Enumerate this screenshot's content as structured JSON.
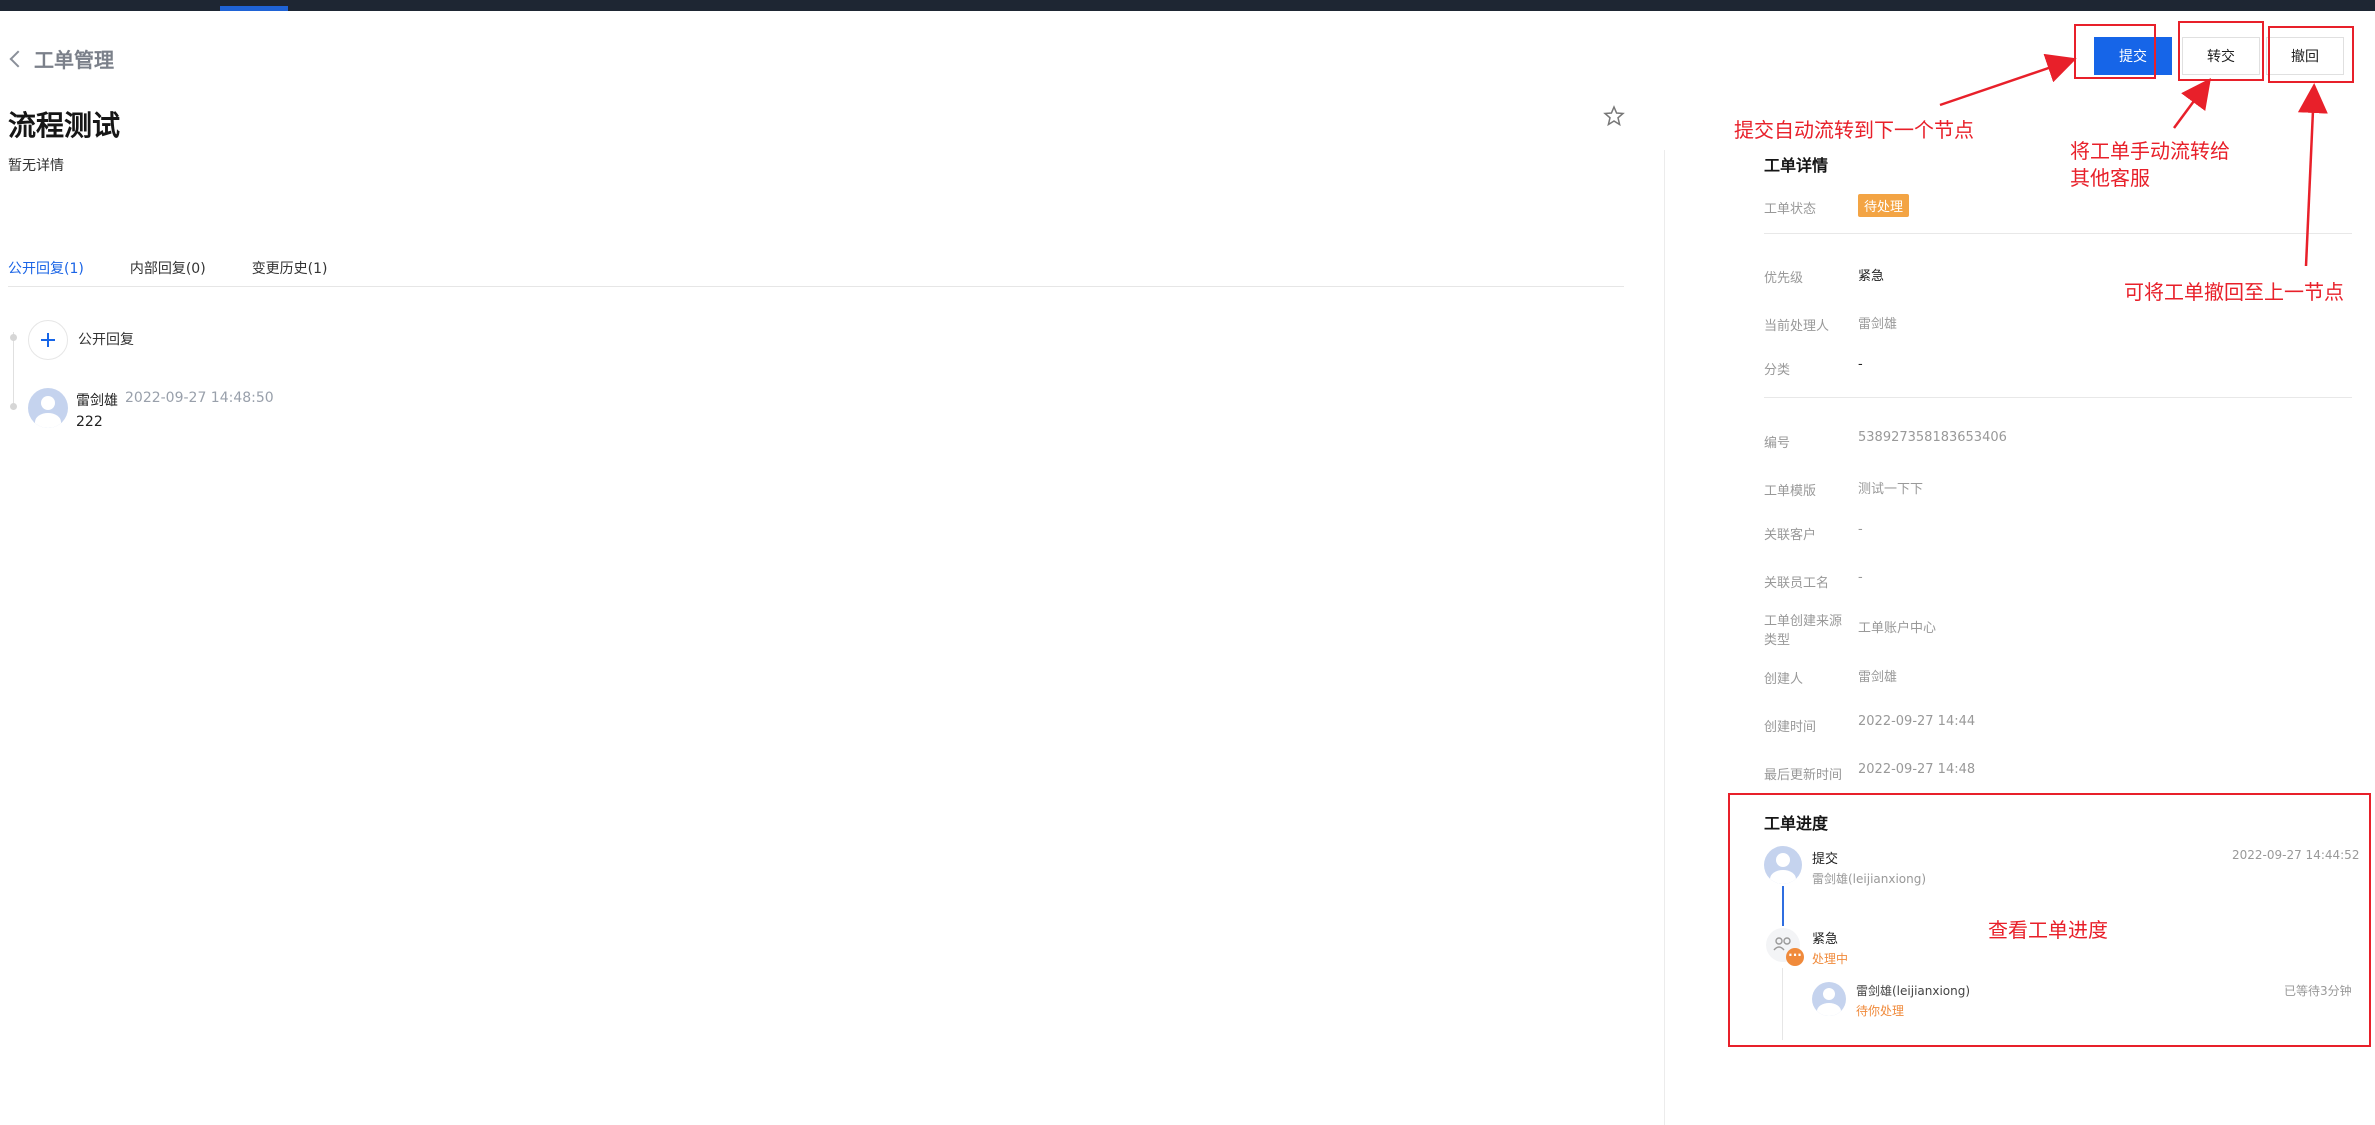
{
  "topbar": {},
  "header": {
    "back_label": "工单管理"
  },
  "ticket": {
    "title": "流程测试",
    "description": "暂无详情"
  },
  "tabs": [
    {
      "label": "公开回复(1)",
      "active": true
    },
    {
      "label": "内部回复(0)",
      "active": false
    },
    {
      "label": "变更历史(1)",
      "active": false
    }
  ],
  "reply_add_label": "公开回复",
  "replies": [
    {
      "author": "雷剑雄",
      "time": "2022-09-27 14:48:50",
      "content": "222"
    }
  ],
  "actions": {
    "submit": "提交",
    "transfer": "转交",
    "withdraw": "撤回"
  },
  "details": {
    "title": "工单详情",
    "status_label": "工单状态",
    "status_value": "待处理",
    "priority_label": "优先级",
    "priority_value": "紧急",
    "handler_label": "当前处理人",
    "handler_value": "雷剑雄",
    "category_label": "分类",
    "category_value": "-",
    "number_label": "编号",
    "number_value": "538927358183653406",
    "template_label": "工单模版",
    "template_value": "测试一下下",
    "customer_label": "关联客户",
    "customer_value": "-",
    "employee_label": "关联员工名",
    "employee_value": "-",
    "source_label": "工单创建来源类型",
    "source_value": "工单账户中心",
    "creator_label": "创建人",
    "creator_value": "雷剑雄",
    "created_label": "创建时间",
    "created_value": "2022-09-27 14:44",
    "updated_label": "最后更新时间",
    "updated_value": "2022-09-27 14:48"
  },
  "progress": {
    "title": "工单进度",
    "step1": {
      "name": "提交",
      "user": "雷剑雄(leijianxiong)",
      "time": "2022-09-27 14:44:52"
    },
    "step2": {
      "name": "紧急",
      "status": "处理中"
    },
    "step2_user": {
      "user": "雷剑雄(leijianxiong)",
      "status": "待你处理",
      "wait": "已等待3分钟"
    }
  },
  "annotations": {
    "submit_note": "提交自动流转到下一个节点",
    "transfer_note_1": "将工单手动流转给",
    "transfer_note_2": "其他客服",
    "withdraw_note": "可将工单撤回至上一节点",
    "progress_note": "查看工单进度"
  },
  "colors": {
    "accent": "#1665e8",
    "annotation": "#e8202a",
    "warning": "#f3a444",
    "topbar": "#1e2633"
  }
}
